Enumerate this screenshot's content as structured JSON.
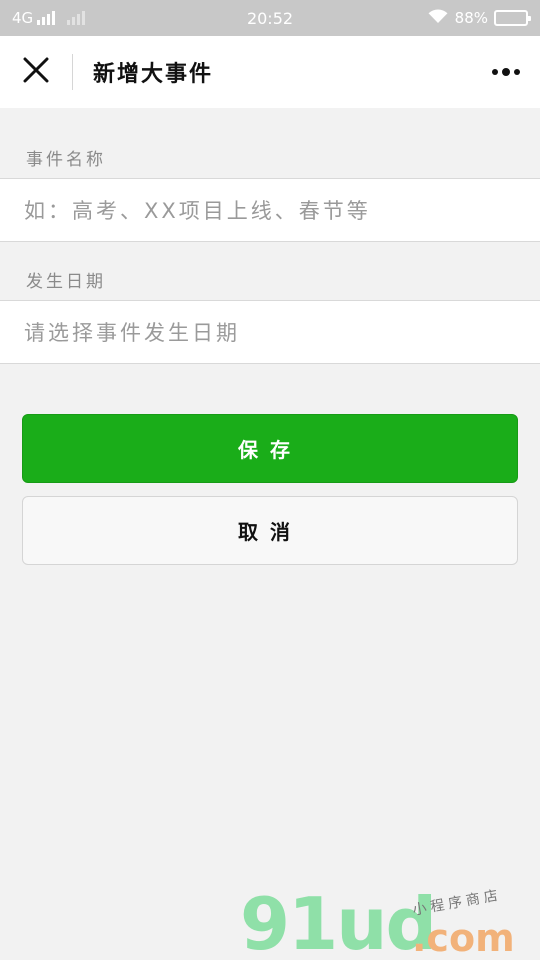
{
  "status_bar": {
    "network": "4G",
    "time": "20:52",
    "battery_text": "88%",
    "battery_level": 0.88
  },
  "header": {
    "title": "新增大事件"
  },
  "form": {
    "event_name": {
      "label": "事件名称",
      "placeholder": "如：高考、XX项目上线、春节等"
    },
    "event_date": {
      "label": "发生日期",
      "placeholder": "请选择事件发生日期"
    }
  },
  "buttons": {
    "save_label": "保存",
    "cancel_label": "取消"
  },
  "watermark": {
    "logo": "91ud",
    "domain": ".com",
    "tagline": "小程序商店"
  },
  "colors": {
    "primary": "#1aad19",
    "status_bar": "#c8c8c8",
    "background": "#f2f2f2"
  }
}
